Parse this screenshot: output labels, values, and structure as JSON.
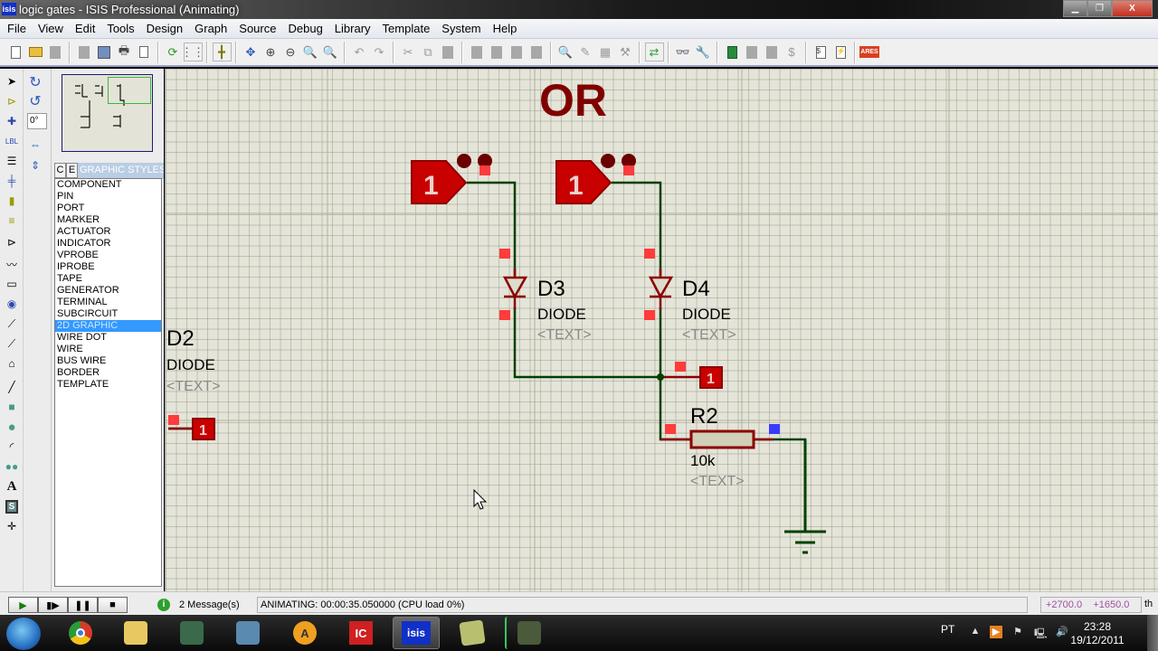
{
  "window": {
    "app_icon": "isis",
    "title": "logic gates - ISIS Professional (Animating)",
    "controls": {
      "minimize": "minimize-icon",
      "restore": "restore-icon",
      "close": "close-icon"
    }
  },
  "menu": [
    "File",
    "View",
    "Edit",
    "Tools",
    "Design",
    "Graph",
    "Source",
    "Debug",
    "Library",
    "Template",
    "System",
    "Help"
  ],
  "toolbar": {
    "buttons": [
      "new-icon",
      "open-icon",
      "save-icon",
      "|",
      "import-icon",
      "export-icon",
      "print-icon",
      "page-setup-icon",
      "|",
      "redraw-icon",
      "grid-icon",
      "|",
      "origin-icon",
      "|",
      "pan-icon",
      "zoom-in-icon",
      "zoom-out-icon",
      "zoom-all-icon",
      "zoom-area-icon",
      "|",
      "undo-icon",
      "redo-icon",
      "|",
      "cut-icon",
      "copy-icon",
      "paste-icon",
      "|",
      "block-copy-icon",
      "block-move-icon",
      "block-rotate-icon",
      "block-delete-icon",
      "|",
      "pick-device-icon",
      "make-device-icon",
      "packaging-tool-icon",
      "decompose-icon",
      "|",
      "wire-autorouter-icon",
      "|",
      "search-icon",
      "property-assignment-icon",
      "|",
      "new-sheet-icon",
      "remove-sheet-icon",
      "exit-to-parent-icon",
      "view-bom-icon",
      "|",
      "netlist-icon",
      "electrical-rule-check-icon",
      "|",
      "ares-icon"
    ],
    "ares_label": "ARES"
  },
  "left_tools": {
    "mode_tools": [
      "selection-icon",
      "component-icon",
      "junction-dot-icon",
      "wire-label-icon",
      "text-script-icon",
      "bus-icon",
      "subcircuit-icon",
      "terminals-icon",
      "device-pins-icon",
      "graph-icon",
      "tape-recorder-icon",
      "generator-icon",
      "voltage-probe-icon",
      "current-probe-icon",
      "virtual-instruments-icon",
      "line-icon",
      "box-icon",
      "circle-icon",
      "arc-icon",
      "path-icon",
      "text-icon",
      "symbol-icon",
      "marker-icon"
    ],
    "wire_label_text": "LBL",
    "text_glyph": "A",
    "symbol_glyph": "S",
    "orientation": {
      "rotate_cw": "rotate-clockwise-icon",
      "rotate_ccw": "rotate-anticlockwise-icon",
      "angle_value": "0°",
      "mirror_x": "mirror-horizontal-icon",
      "mirror_y": "mirror-vertical-icon"
    }
  },
  "library": {
    "tab_c": "C",
    "tab_e": "E",
    "title": "GRAPHIC STYLES",
    "items": [
      "COMPONENT",
      "PIN",
      "PORT",
      "MARKER",
      "ACTUATOR",
      "INDICATOR",
      "VPROBE",
      "IPROBE",
      "TAPE",
      "GENERATOR",
      "TERMINAL",
      "SUBCIRCUIT",
      "2D GRAPHIC",
      "WIRE DOT",
      "WIRE",
      "BUS WIRE",
      "BORDER",
      "TEMPLATE"
    ],
    "selected": "2D GRAPHIC"
  },
  "schematic": {
    "title": "OR",
    "colors": {
      "title": "#800000",
      "wire": "#004000",
      "component": "#8b0000",
      "pin_active": "#ff3b3b",
      "pin_low": "#3333ff",
      "logic_fill": "#c80000"
    },
    "logic_states": [
      {
        "id": "input-1",
        "value": "1"
      },
      {
        "id": "input-2",
        "value": "1"
      },
      {
        "id": "output-probe",
        "value": "1"
      },
      {
        "id": "d2-probe",
        "value": "1"
      }
    ],
    "components": [
      {
        "ref": "D3",
        "value": "DIODE",
        "text": "<TEXT>"
      },
      {
        "ref": "D4",
        "value": "DIODE",
        "text": "<TEXT>"
      },
      {
        "ref": "D2",
        "value": "DIODE",
        "text": "<TEXT>"
      },
      {
        "ref": "R2",
        "value": "10k",
        "text": "<TEXT>"
      }
    ]
  },
  "statusbar": {
    "sim_controls": {
      "play": "play-icon",
      "step": "step-icon",
      "pause": "pause-icon",
      "stop": "stop-icon"
    },
    "messages": "2 Message(s)",
    "animation_status": "ANIMATING: 00:00:35.050000 (CPU load 0%)",
    "coord_x": "+2700.0",
    "coord_y": "+1650.0",
    "units": "th"
  },
  "taskbar": {
    "apps": [
      "chrome",
      "windows-explorer",
      "remote-desktop",
      "messenger",
      "avast",
      "ic-app",
      "isis",
      "notes",
      "media"
    ],
    "isis_label": "isis",
    "ic_label": "IC",
    "language": "PT",
    "time": "23:28",
    "date": "19/12/2011"
  }
}
